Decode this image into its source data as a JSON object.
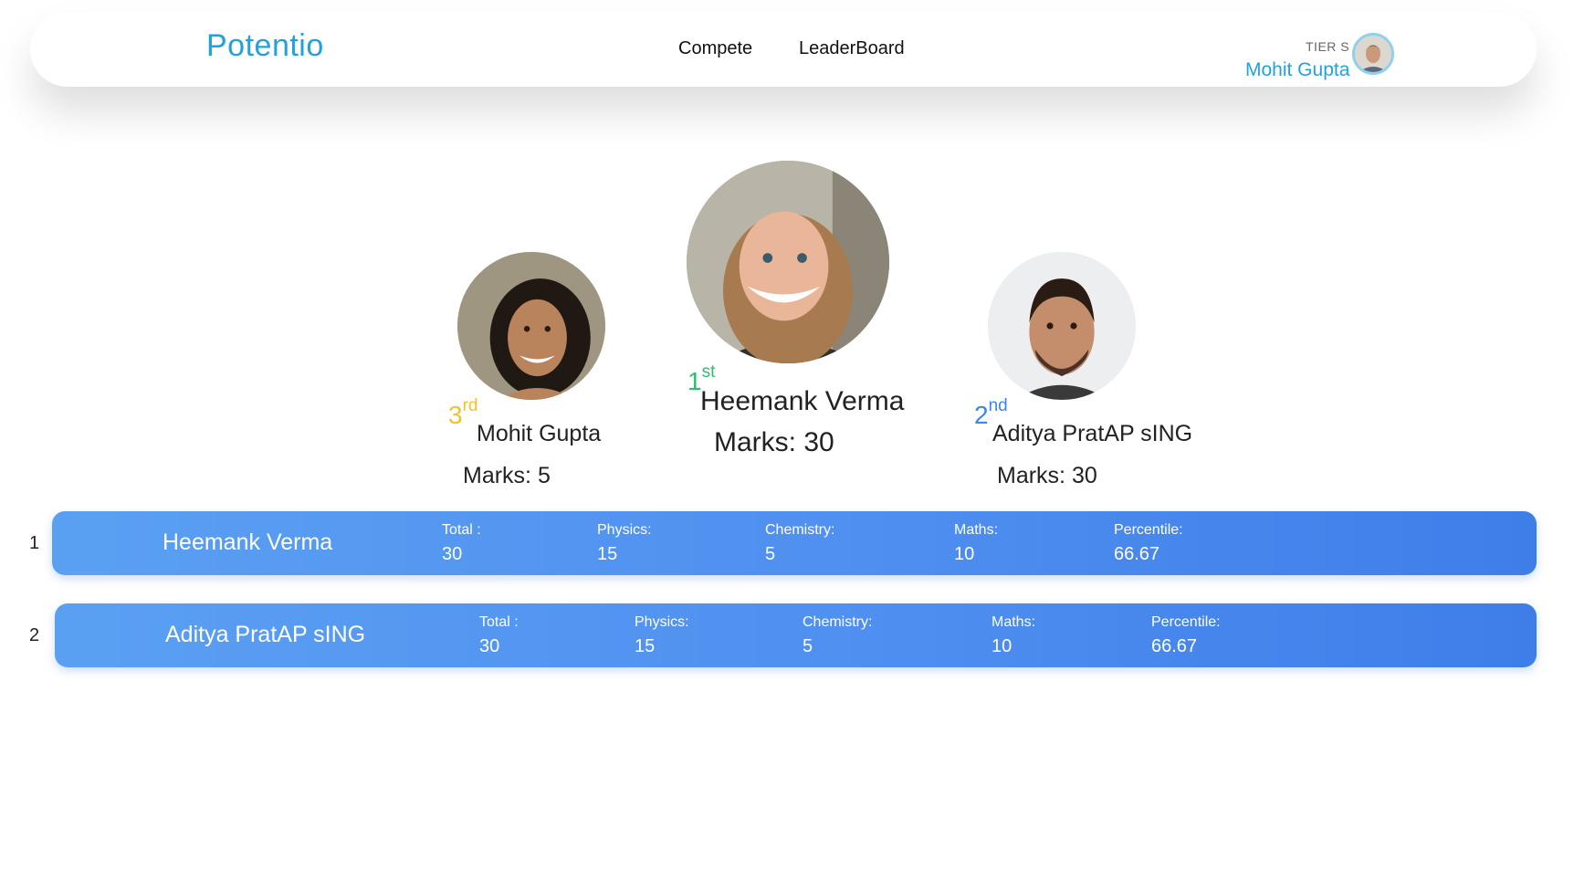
{
  "brand": "Potentio",
  "nav": {
    "compete": "Compete",
    "leaderboard": "LeaderBoard"
  },
  "user": {
    "tier": "TIER S",
    "name": "Mohit Gupta"
  },
  "podium": {
    "first": {
      "rank": "1",
      "suffix": "st",
      "name": "Heemank Verma",
      "marks": "Marks: 30"
    },
    "second": {
      "rank": "2",
      "suffix": "nd",
      "name": "Aditya PratAP sING",
      "marks": "Marks: 30"
    },
    "third": {
      "rank": "3",
      "suffix": "rd",
      "name": "Mohit Gupta",
      "marks": "Marks: 5"
    }
  },
  "rows": [
    {
      "index": "1",
      "name": "Heemank Verma",
      "total_label": "Total :",
      "total": "30",
      "physics_label": "Physics:",
      "physics": "15",
      "chemistry_label": "Chemistry:",
      "chemistry": "5",
      "maths_label": "Maths:",
      "maths": "10",
      "percentile_label": "Percentile:",
      "percentile": "66.67"
    },
    {
      "index": "2",
      "name": "Aditya PratAP sING",
      "total_label": "Total :",
      "total": "30",
      "physics_label": "Physics:",
      "physics": "15",
      "chemistry_label": "Chemistry:",
      "chemistry": "5",
      "maths_label": "Maths:",
      "maths": "10",
      "percentile_label": "Percentile:",
      "percentile": "66.67"
    }
  ],
  "colors": {
    "brand": "#22a2dd",
    "rank_first": "#2bbf6a",
    "rank_second": "#3b86ea",
    "rank_third": "#f2c22b",
    "row_gradient_start": "#5aa0f2",
    "row_gradient_end": "#3e7ee9"
  }
}
